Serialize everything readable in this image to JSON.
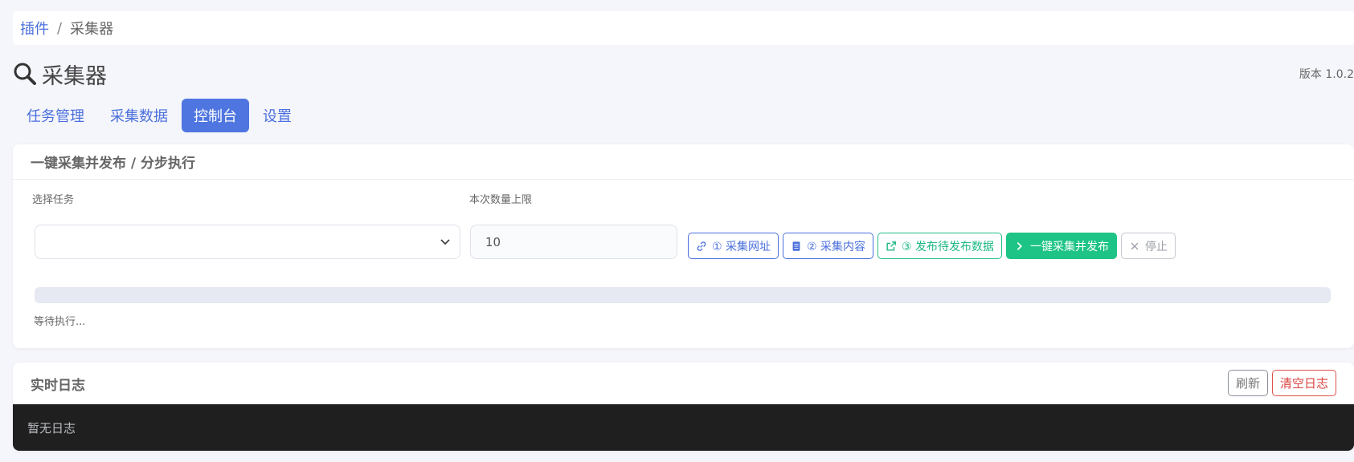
{
  "breadcrumb": {
    "parent": "插件",
    "separator": "/",
    "current": "采集器"
  },
  "header": {
    "title": "采集器",
    "version": "版本 1.0.2",
    "icon": "search-icon"
  },
  "tabs": [
    {
      "label": "任务管理",
      "active": false
    },
    {
      "label": "采集数据",
      "active": false
    },
    {
      "label": "控制台",
      "active": true
    },
    {
      "label": "设置",
      "active": false
    }
  ],
  "panel": {
    "title": "一键采集并发布 / 分步执行",
    "task_select": {
      "label": "选择任务",
      "value": ""
    },
    "limit_input": {
      "label": "本次数量上限",
      "value": "10"
    },
    "buttons": {
      "collect_urls": "① 采集网址",
      "collect_content": "② 采集内容",
      "publish_pending": "③ 发布待发布数据",
      "one_click": "一键采集并发布",
      "stop": "停止"
    },
    "progress_percent": 0,
    "status": "等待执行..."
  },
  "log": {
    "title": "实时日志",
    "refresh_label": "刷新",
    "clear_label": "清空日志",
    "empty_text": "暂无日志"
  },
  "colors": {
    "primary": "#4e75e0",
    "success": "#1ec486",
    "danger": "#d9433d",
    "log_bg": "#1f1f1f"
  }
}
